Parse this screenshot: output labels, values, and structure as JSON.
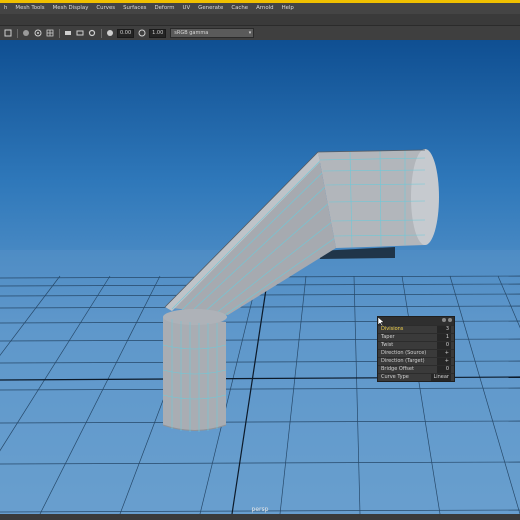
{
  "menubar": {
    "items": [
      "h",
      "Mesh Tools",
      "Mesh Display",
      "Curves",
      "Surfaces",
      "Deform",
      "UV",
      "Generate",
      "Cache",
      "Arnold",
      "Help"
    ]
  },
  "toolbar": {
    "field1": "0.00",
    "field2": "1.00",
    "colorspace": "sRGB gamma",
    "icons": [
      "display-icon",
      "render-icon",
      "snapshot-icon",
      "grid-icon",
      "camera-icon",
      "camera-alt-icon",
      "gear-icon",
      "exposure-icon",
      "gamma-icon"
    ]
  },
  "viewport": {
    "camera_label": "persp",
    "background_top": "#0f4f92",
    "background_bottom": "#6ea4d1"
  },
  "bridge_popup": {
    "rows": [
      {
        "label": "Divisions",
        "value": "3"
      },
      {
        "label": "Taper",
        "value": "1"
      },
      {
        "label": "Twist",
        "value": "0"
      },
      {
        "label": "Direction (Source)",
        "value": "+"
      },
      {
        "label": "Direction (Target)",
        "value": "+"
      },
      {
        "label": "Bridge Offset",
        "value": "0"
      },
      {
        "label": "Curve Type",
        "value": "Linear"
      }
    ]
  }
}
